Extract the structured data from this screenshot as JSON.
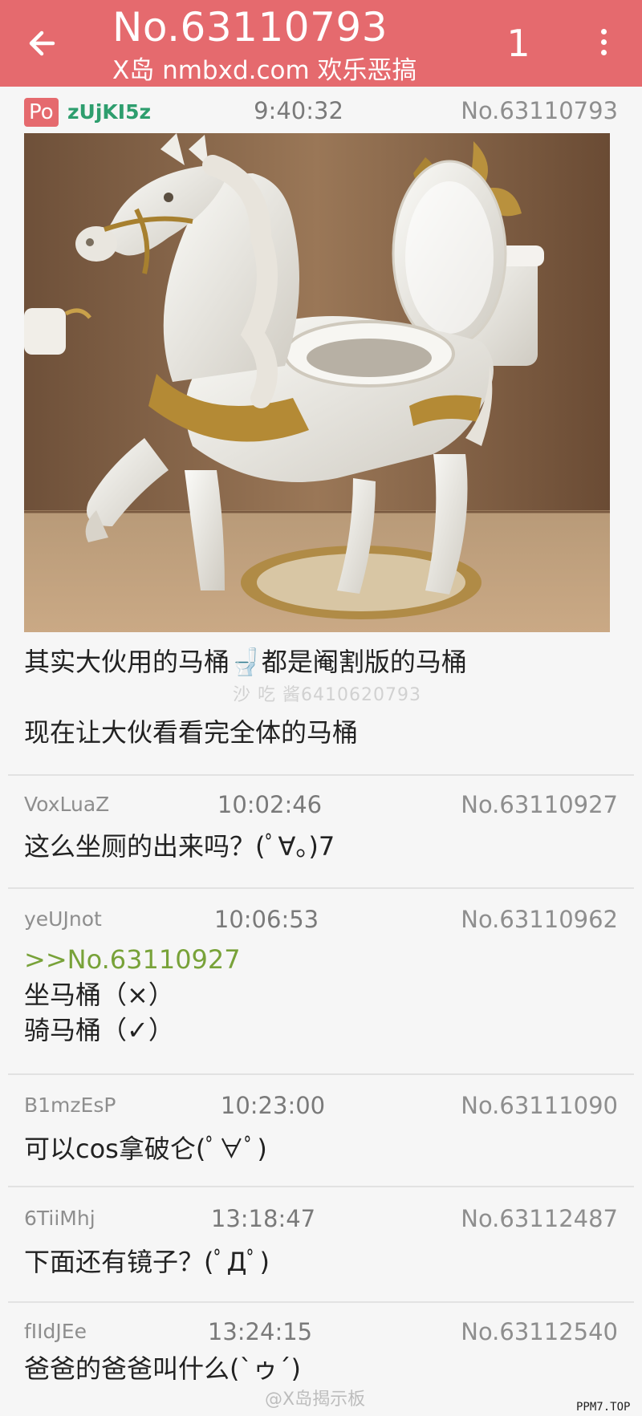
{
  "header": {
    "title": "No.63110793",
    "subtitle": "X岛 nmbxd.com 欢乐恶搞",
    "page": "1"
  },
  "thread": {
    "op": {
      "badge": "Po",
      "uid": "zUjKI5z",
      "time": "9:40:32",
      "id": "No.63110793",
      "lines": [
        "其实大伙用的马桶🚽都是阉割版的马桶",
        "现在让大伙看看完全体的马桶"
      ]
    },
    "replies": [
      {
        "uid": "VoxLuaZ",
        "time": "10:02:46",
        "id": "No.63110927",
        "quote": "",
        "lines": [
          "这么坐厕的出来吗？(ﾟ∀。)7"
        ]
      },
      {
        "uid": "yeUJnot",
        "time": "10:06:53",
        "id": "No.63110962",
        "quote": ">>No.63110927",
        "lines": [
          "坐马桶（×）",
          "骑马桶（✓）"
        ]
      },
      {
        "uid": "B1mzEsP",
        "time": "10:23:00",
        "id": "No.63111090",
        "quote": "",
        "lines": [
          "可以cos拿破仑(ﾟ∀ﾟ)"
        ]
      },
      {
        "uid": "6TiiMhj",
        "time": "13:18:47",
        "id": "No.63112487",
        "quote": "",
        "lines": [
          "下面还有镜子？(ﾟДﾟ)"
        ]
      },
      {
        "uid": "fIIdJEe",
        "time": "13:24:15",
        "id": "No.63112540",
        "quote": "",
        "lines": [
          "爸爸的爸爸叫什么(`ゥ´)"
        ]
      }
    ]
  },
  "overlay": {
    "stamp": "沙 吃 酱6410620793",
    "footer": "@X岛揭示板",
    "corner": "PPM7.TOP"
  },
  "colors": {
    "accent": "#e56a6e",
    "quote": "#78a239",
    "po_uid": "#2e9e6e"
  },
  "icons": [
    "back-arrow-icon",
    "more-vert-icon"
  ]
}
